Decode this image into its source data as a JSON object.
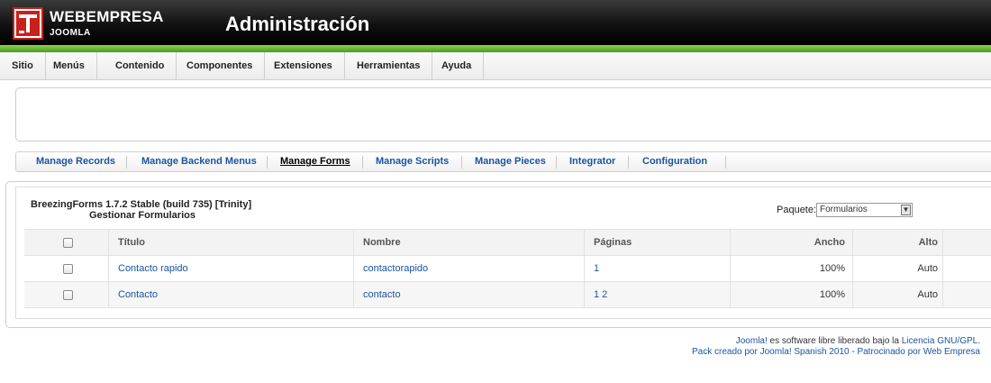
{
  "header": {
    "logo_line1": "WEBEMPRESA",
    "logo_line2": "JOOMLA",
    "title": "Administración"
  },
  "menu": [
    "Sitio",
    "Menús",
    "Contenido",
    "Componentes",
    "Extensiones",
    "Herramientas",
    "Ayuda"
  ],
  "submenu": {
    "items": [
      "Manage Records",
      "Manage Backend Menus",
      "Manage Forms",
      "Manage Scripts",
      "Manage Pieces",
      "Integrator",
      "Configuration"
    ],
    "active": "Manage Forms"
  },
  "content": {
    "title": "BreezingForms 1.7.2 Stable (build 735) [Trinity]",
    "subtitle": "Gestionar Formularios",
    "paquete_label": "Paquete:",
    "paquete_value": "Formularios"
  },
  "table": {
    "headers": [
      "Título",
      "Nombre",
      "Páginas",
      "Ancho",
      "Alto"
    ],
    "rows": [
      {
        "titulo": "Contacto rapido",
        "nombre": "contactorapido",
        "paginas": "1",
        "ancho": "100%",
        "alto": "Auto"
      },
      {
        "titulo": "Contacto",
        "nombre": "contacto",
        "paginas": "1 2",
        "ancho": "100%",
        "alto": "Auto"
      }
    ]
  },
  "footer": {
    "joomla_link": "Joomla!",
    "text1": " es software libre liberado bajo la ",
    "license_link": "Licencia GNU/GPL",
    "period": ".",
    "pack_link": "Pack creado por Joomla! Spanish 2010",
    "dash": " - ",
    "sponsor_link": "Patrocinado por Web Empresa"
  },
  "colors": {
    "link": "#1a55a0",
    "header_bg": "#111111",
    "header_accent": "#6cb33f"
  }
}
